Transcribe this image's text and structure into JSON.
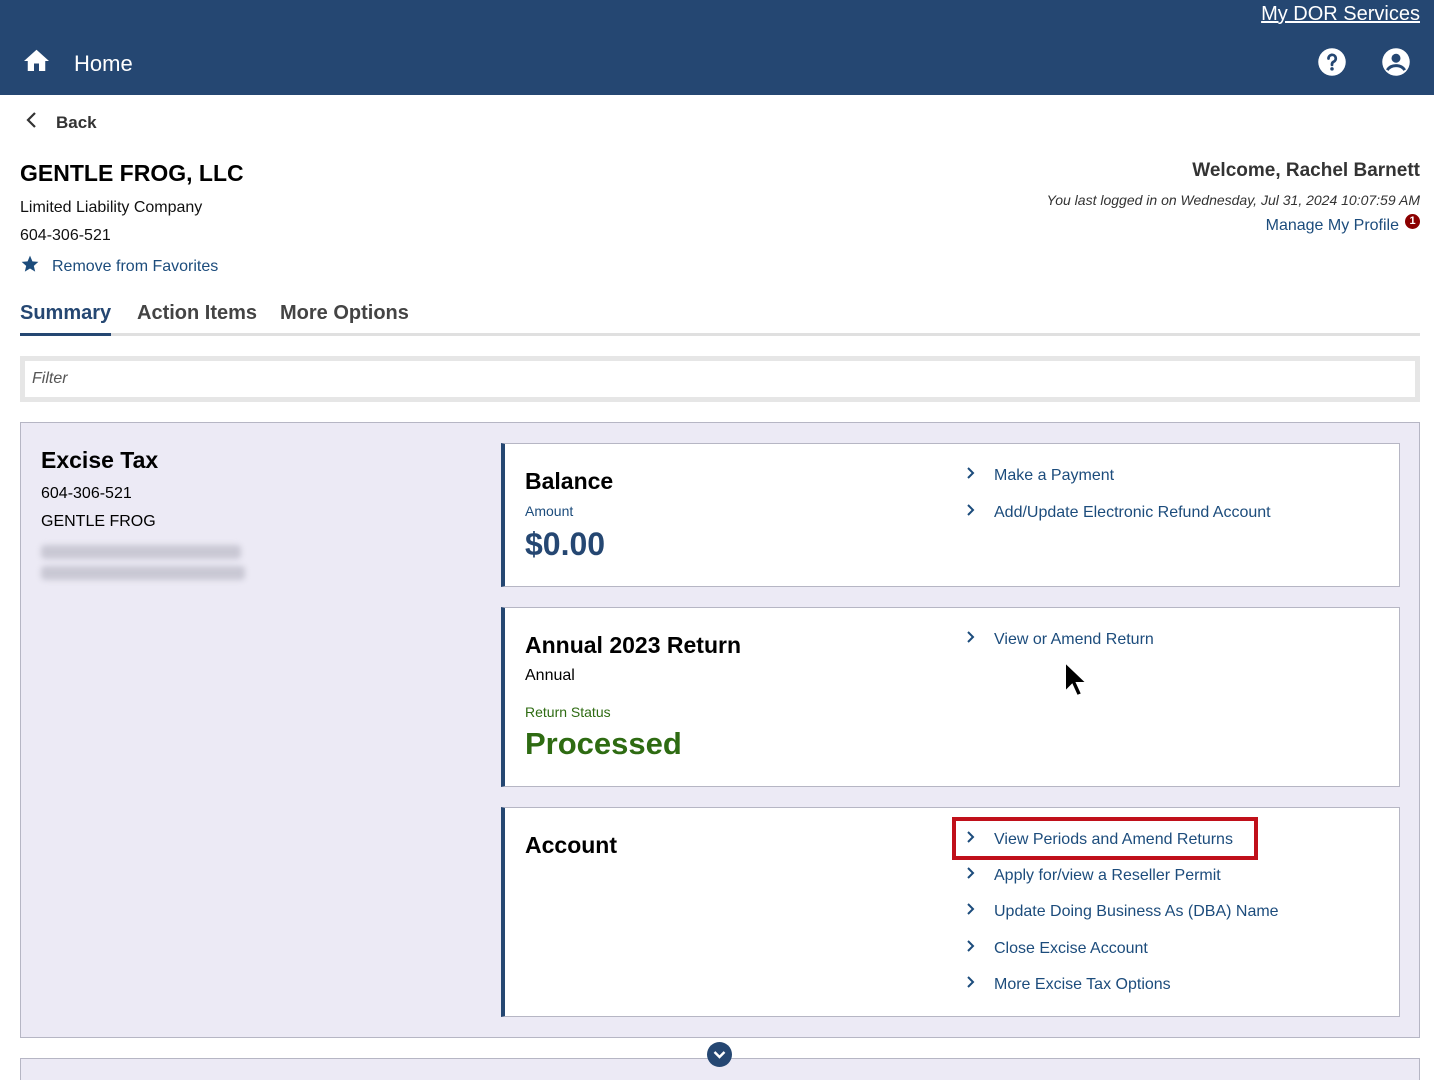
{
  "header": {
    "services_link": "My DOR Services",
    "home_label": "Home",
    "help_icon": "help-circle-icon",
    "account_icon": "account-circle-icon",
    "bg_color": "#254772"
  },
  "back_label": "Back",
  "taxpayer": {
    "name": "GENTLE FROG, LLC",
    "entity_type": "Limited Liability Company",
    "id": "604-306-521",
    "favorites_label": "Remove from Favorites"
  },
  "user": {
    "welcome": "Welcome, Rachel Barnett",
    "last_login": "You last logged in on Wednesday, Jul 31, 2024 10:07:59 AM",
    "profile_link": "Manage My Profile",
    "profile_badge": "1"
  },
  "tabs": [
    {
      "label": "Summary",
      "active": true
    },
    {
      "label": "Action Items",
      "active": false
    },
    {
      "label": "More Options",
      "active": false
    }
  ],
  "filter": {
    "placeholder": "Filter",
    "value": ""
  },
  "account": {
    "title": "Excise Tax",
    "id": "604-306-521",
    "name": "GENTLE FROG"
  },
  "cards": {
    "balance": {
      "title": "Balance",
      "amount_label": "Amount",
      "amount": "$0.00",
      "links": [
        "Make a Payment",
        "Add/Update Electronic Refund Account"
      ]
    },
    "return": {
      "title": "Annual 2023 Return",
      "frequency": "Annual",
      "status_label": "Return Status",
      "status": "Processed",
      "links": [
        "View or Amend Return"
      ]
    },
    "account": {
      "title": "Account",
      "links": [
        "View Periods and Amend Returns",
        "Apply for/view a Reseller Permit",
        "Update Doing Business As (DBA) Name",
        "Close Excise Account",
        "More Excise Tax Options"
      ]
    }
  },
  "colors": {
    "link": "#1c4c7c",
    "amount": "#254772",
    "status_green": "#2e6b12",
    "highlight": "#c0101a"
  }
}
